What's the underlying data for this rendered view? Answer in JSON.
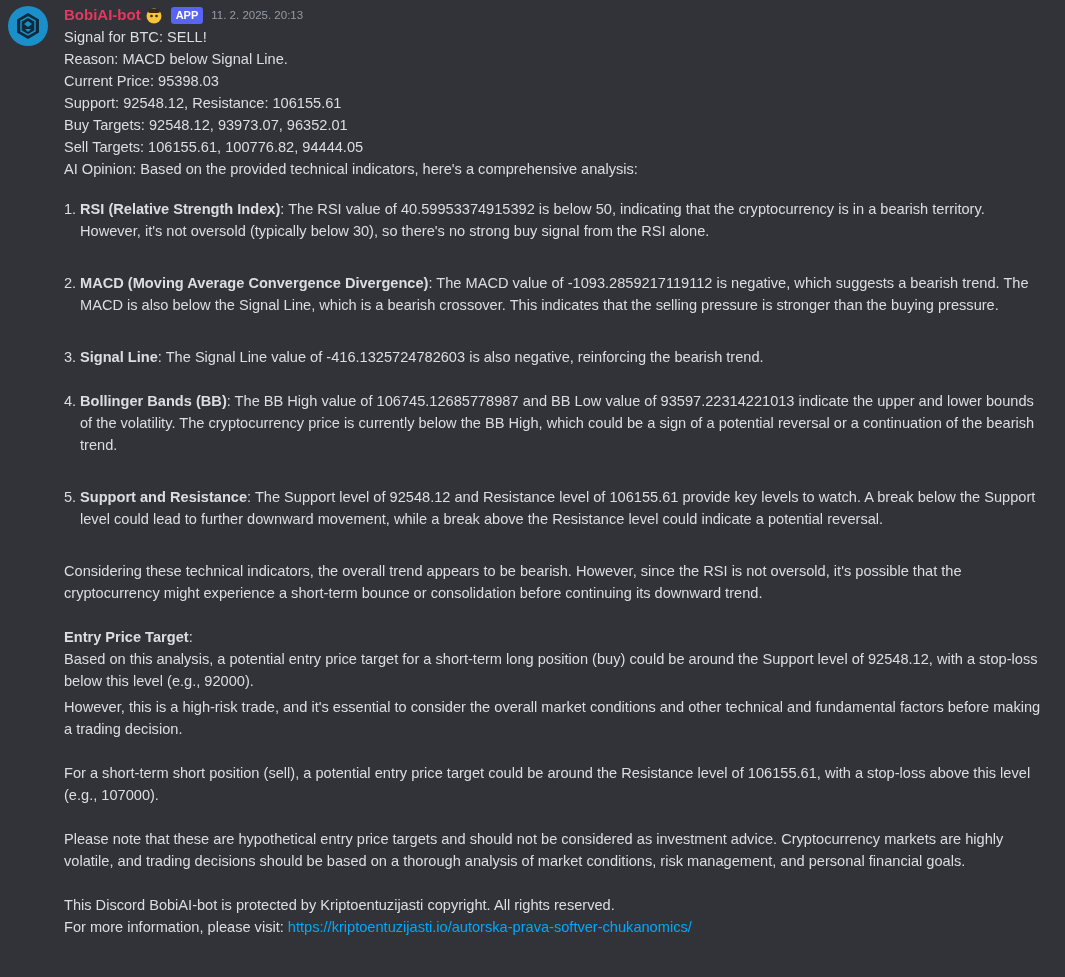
{
  "message": {
    "author": "BobiAI-bot",
    "tag": "APP",
    "timestamp": "11. 2. 2025. 20:13",
    "lines": [
      "Signal for BTC: SELL!",
      "Reason: MACD below Signal Line.",
      "Current Price: 95398.03",
      "Support: 92548.12, Resistance: 106155.61",
      "Buy Targets: 92548.12, 93973.07, 96352.01",
      "Sell Targets: 106155.61, 100776.82, 94444.05",
      "AI Opinion: Based on the provided technical indicators, here's a comprehensive analysis:"
    ],
    "items": [
      {
        "number": "1.",
        "text": "**RSI (Relative Strength Index)**: The RSI value of 40.59953374915392 is below 50, indicating that the cryptocurrency is in a bearish territory. However, it's not oversold (typically below 30), so there's no strong buy signal from the RSI alone."
      },
      {
        "number": "2.",
        "text": "**MACD (Moving Average Convergence Divergence)**: The MACD value of -1093.2859217119112 is negative, which suggests a bearish trend. The MACD is also below the Signal Line, which is a bearish crossover. This indicates that the selling pressure is stronger than the buying pressure."
      },
      {
        "number": "3.",
        "text": "**Signal Line**: The Signal Line value of -416.1325724782603 is also negative, reinforcing the bearish trend."
      },
      {
        "number": "4.",
        "text": "**Bollinger Bands (BB)**: The BB High value of 106745.12685778987 and BB Low value of 93597.22314221013 indicate the upper and lower bounds of the volatility. The cryptocurrency price is currently below the BB High, which could be a sign of a potential reversal or a continuation of the bearish trend."
      },
      {
        "number": "5.",
        "text": "**Support and Resistance**: The Support level of 92548.12 and Resistance level of 106155.61 provide key levels to watch. A break below the Support level could lead to further downward movement, while a break above the Resistance level could indicate a potential reversal."
      }
    ],
    "paragraphs": [
      {
        "kind": "paragraph",
        "text": "Considering these technical indicators, the overall trend appears to be bearish. However, since the RSI is not oversold, it's possible that the cryptocurrency might experience a short-term bounce or consolidation before continuing its downward trend."
      },
      {
        "kind": "heading",
        "text": "**Entry Price Target**:"
      },
      {
        "kind": "line",
        "text": "Based on this analysis, a potential entry price target for a short-term long position (buy) could be around the Support level of 92548.12, with a stop-loss below this level (e.g., 92000)."
      },
      {
        "kind": "line",
        "text": "However, this is a high-risk trade, and it's essential to consider the overall market conditions and other technical and fundamental factors before making a trading decision."
      },
      {
        "kind": "paragraph",
        "text": "For a short-term short position (sell), a potential entry price target could be around the Resistance level of 106155.61, with a stop-loss above this level (e.g., 107000)."
      },
      {
        "kind": "paragraph",
        "text": "Please note that these are hypothetical entry price targets and should not be considered as investment advice. Cryptocurrency markets are highly volatile, and trading decisions should be based on a thorough analysis of market conditions, risk management, and personal financial goals."
      },
      {
        "kind": "paragraph",
        "text": "This Discord BobiAI-bot is protected by Kriptoentuzijasti copyright. All rights reserved."
      },
      {
        "kind": "link_line",
        "text": "For more information, please visit: ",
        "link": "https://kriptoentuzijasti.io/autorska-prava-softver-chukanomics/"
      }
    ]
  }
}
